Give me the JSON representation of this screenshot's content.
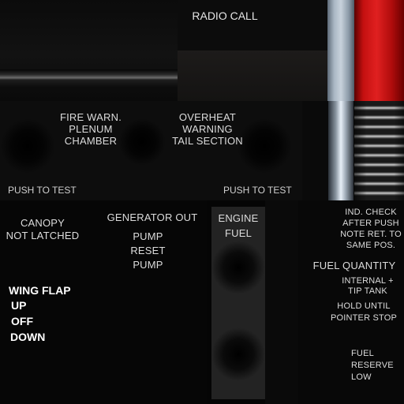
{
  "radio": {
    "title": "RADIO CALL"
  },
  "warnings": {
    "fire": [
      "FIRE WARN.",
      "PLENUM",
      "CHAMBER"
    ],
    "overheat": [
      "OVERHEAT",
      "WARNING",
      "TAIL SECTION"
    ],
    "push_left": "PUSH TO TEST",
    "push_right": "PUSH TO TEST"
  },
  "canopy": [
    "CANOPY",
    "NOT LATCHED"
  ],
  "generator": {
    "title": "GENERATOR OUT",
    "lines": [
      "PUMP",
      "RESET",
      "PUMP"
    ]
  },
  "engine": [
    "ENGINE",
    "FUEL"
  ],
  "wing_flap": {
    "title": "WING FLAP",
    "positions": [
      "UP",
      "OFF",
      "DOWN"
    ]
  },
  "ind_check": [
    "IND. CHECK",
    "AFTER PUSH",
    "NOTE RET. TO",
    "SAME POS."
  ],
  "fuel_quantity": {
    "title": "FUEL QUANTITY",
    "tank": [
      "INTERNAL +",
      "TIP TANK"
    ],
    "hold": [
      "HOLD UNTIL",
      "POINTER STOP"
    ]
  },
  "fuel_reserve": [
    "FUEL",
    "RESERVE",
    "LOW"
  ],
  "colors": {
    "red_cap": "#d41818",
    "blue_cap": "#aab7c4",
    "background": "#050505"
  }
}
